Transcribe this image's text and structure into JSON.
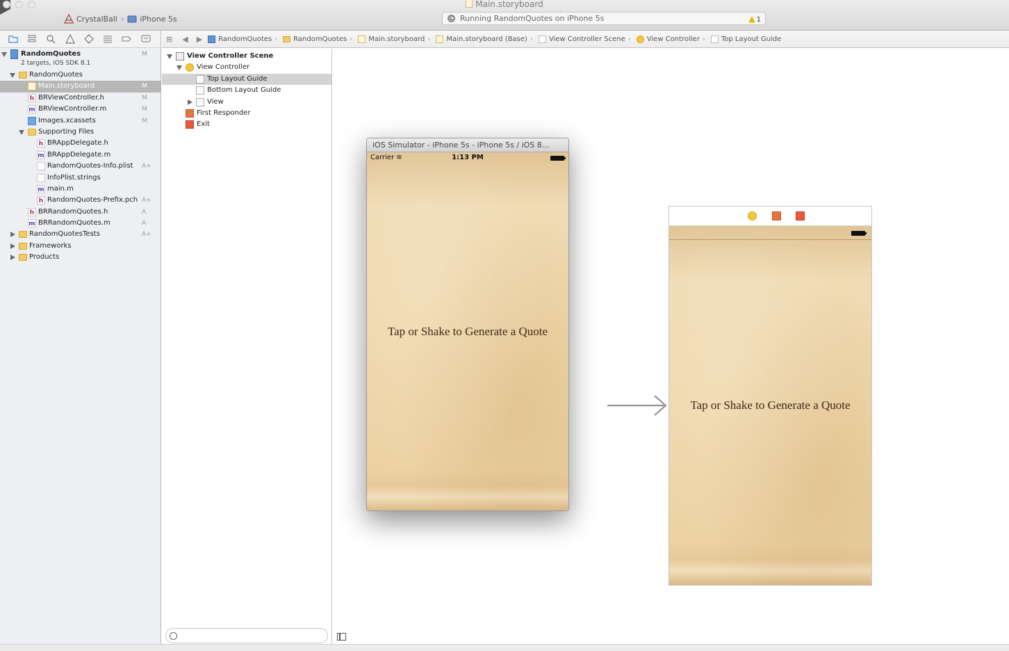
{
  "window": {
    "title": "Main.storyboard"
  },
  "toolbar": {
    "scheme": "CrystalBall",
    "destination": "iPhone 5s",
    "status": "Running RandomQuotes on iPhone 5s",
    "warning_count": "1"
  },
  "navigator": {
    "project": {
      "name": "RandomQuotes",
      "subtitle": "2 targets, iOS SDK 8.1",
      "badge": "M"
    },
    "items": [
      {
        "label": "RandomQuotes",
        "badge": ""
      },
      {
        "label": "Main.storyboard",
        "badge": "M"
      },
      {
        "label": "BRViewController.h",
        "badge": "M"
      },
      {
        "label": "BRViewController.m",
        "badge": "M"
      },
      {
        "label": "Images.xcassets",
        "badge": "M"
      },
      {
        "label": "Supporting Files",
        "badge": ""
      },
      {
        "label": "BRAppDelegate.h",
        "badge": ""
      },
      {
        "label": "BRAppDelegate.m",
        "badge": ""
      },
      {
        "label": "RandomQuotes-Info.plist",
        "badge": "A+"
      },
      {
        "label": "InfoPlist.strings",
        "badge": ""
      },
      {
        "label": "main.m",
        "badge": ""
      },
      {
        "label": "RandomQuotes-Prefix.pch",
        "badge": "A+"
      },
      {
        "label": "BRRandomQuotes.h",
        "badge": "A"
      },
      {
        "label": "BRRandomQuotes.m",
        "badge": "A"
      },
      {
        "label": "RandomQuotesTests",
        "badge": "A+"
      },
      {
        "label": "Frameworks",
        "badge": ""
      },
      {
        "label": "Products",
        "badge": ""
      }
    ]
  },
  "jumpbar": {
    "crumbs": [
      "RandomQuotes",
      "RandomQuotes",
      "Main.storyboard",
      "Main.storyboard (Base)",
      "View Controller Scene",
      "View Controller",
      "Top Layout Guide"
    ]
  },
  "outline": {
    "scene": "View Controller Scene",
    "view_controller": "View Controller",
    "top_layout_guide": "Top Layout Guide",
    "bottom_layout_guide": "Bottom Layout Guide",
    "view": "View",
    "first_responder": "First Responder",
    "exit": "Exit"
  },
  "simulator": {
    "title": "iOS Simulator - iPhone 5s - iPhone 5s / iOS 8...",
    "carrier": "Carrier",
    "time": "1:13 PM",
    "quote": "Tap or Shake to Generate a Quote"
  },
  "storyboard": {
    "quote": "Tap or Shake to Generate a Quote"
  },
  "colors": {
    "paper": "#efd6a8",
    "selection": "#b7b7b7",
    "warning": "#e8b400"
  }
}
